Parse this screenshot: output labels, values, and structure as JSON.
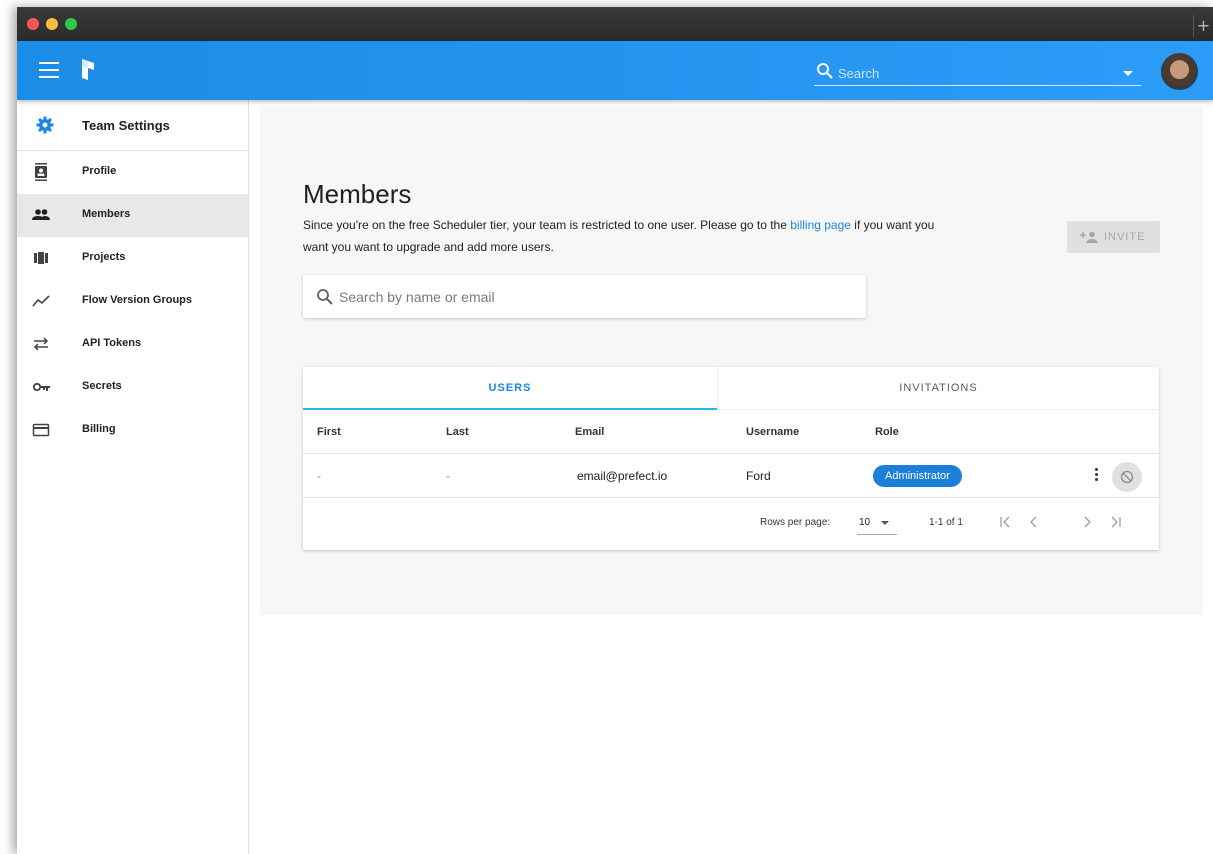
{
  "window": {
    "newtab_symbol": "+"
  },
  "appbar": {
    "search_placeholder": "Search"
  },
  "sidebar": {
    "header_title": "Team Settings",
    "items": [
      {
        "label": "Profile",
        "icon": "profile-icon"
      },
      {
        "label": "Members",
        "icon": "people-icon",
        "active": true
      },
      {
        "label": "Projects",
        "icon": "projects-icon"
      },
      {
        "label": "Flow Version Groups",
        "icon": "trending-icon"
      },
      {
        "label": "API Tokens",
        "icon": "swap-icon"
      },
      {
        "label": "Secrets",
        "icon": "key-icon"
      },
      {
        "label": "Billing",
        "icon": "credit-card-icon"
      }
    ]
  },
  "main": {
    "title": "Members",
    "desc_before": "Since you're on the free Scheduler tier, your team is restricted to one user. Please go to the ",
    "desc_link": "billing page",
    "desc_after": " if you want you want you want to upgrade and add more users.",
    "invite_label": "INVITE",
    "search_placeholder": "Search by name or email"
  },
  "table": {
    "tabs": [
      "USERS",
      "INVITATIONS"
    ],
    "columns": [
      "First",
      "Last",
      "Email",
      "Username",
      "Role"
    ],
    "rows": [
      {
        "first": "-",
        "last": "-",
        "email": "email@prefect.io",
        "username": "Ford",
        "role": "Administrator"
      }
    ],
    "footer": {
      "rows_per_page_label": "Rows per page:",
      "rows_per_page_value": "10",
      "range_text": "1-1 of 1"
    }
  },
  "colors": {
    "appbar": "#2b9cf7",
    "accent": "#1c86e0",
    "badge": "#1c7fd9",
    "tab_indicator": "#29b6e8"
  }
}
